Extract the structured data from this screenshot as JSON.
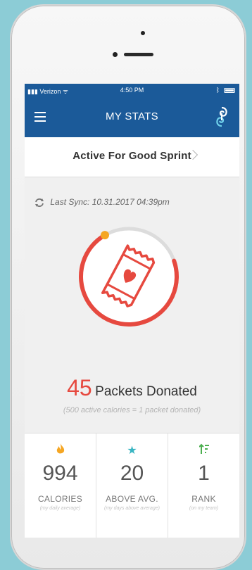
{
  "status": {
    "carrier": "Verizon",
    "time": "4:50 PM"
  },
  "nav": {
    "title": "MY STATS"
  },
  "event": {
    "name": "Active For Good Sprint"
  },
  "sync": {
    "text": "Last Sync: 10.31.2017 04:39pm"
  },
  "donation": {
    "count": "45",
    "label": "Packets Donated",
    "note": "(500 active calories = 1 packet donated)",
    "progress": 0.72
  },
  "stats": [
    {
      "icon": "flame-icon",
      "value": "994",
      "label": "CALORIES",
      "sub": "(my daily average)"
    },
    {
      "icon": "star-icon",
      "value": "20",
      "label": "ABOVE AVG.",
      "sub": "(my days above average)"
    },
    {
      "icon": "rank-icon",
      "value": "1",
      "label": "RANK",
      "sub": "(on my team)"
    }
  ],
  "colors": {
    "accent": "#1b5a99",
    "red": "#e6493f",
    "orange": "#f5a623",
    "teal": "#39b5c2",
    "green": "#4caf50"
  }
}
